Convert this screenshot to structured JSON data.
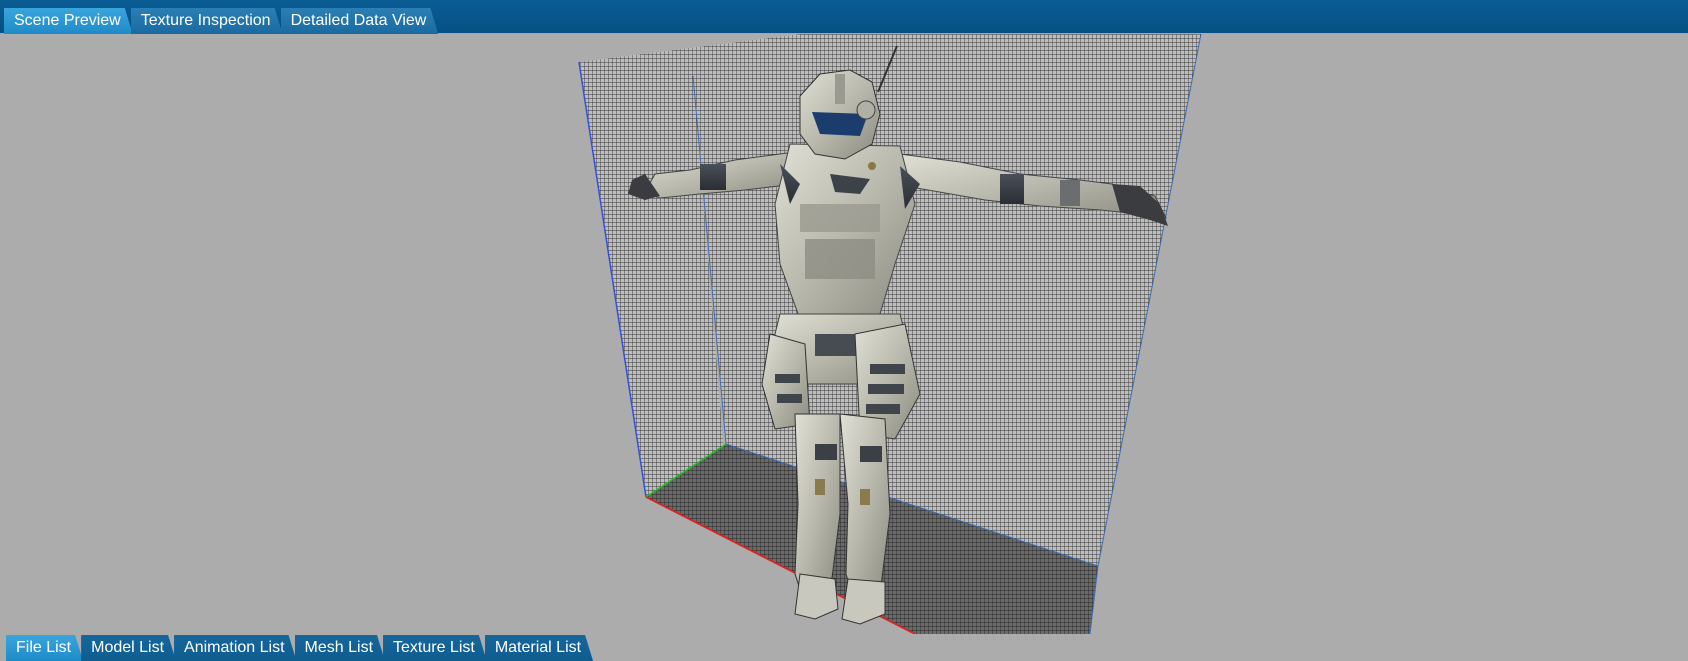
{
  "top_tabs": [
    {
      "label": "Scene Preview",
      "active": true
    },
    {
      "label": "Texture Inspection",
      "active": false
    },
    {
      "label": "Detailed Data View",
      "active": false
    }
  ],
  "bottom_tabs": [
    {
      "label": "File List",
      "active": true
    },
    {
      "label": "Model List",
      "active": false
    },
    {
      "label": "Animation List",
      "active": false
    },
    {
      "label": "Mesh List",
      "active": false
    },
    {
      "label": "Texture List",
      "active": false
    },
    {
      "label": "Material List",
      "active": false
    }
  ],
  "colors": {
    "top_bar": "#045083",
    "active_tab": "#1e8cc8",
    "viewport_bg": "#acacac",
    "axis_x": "#e02020",
    "axis_y": "#20c020",
    "axis_z": "#2040e0"
  },
  "viewport": {
    "model_icon": "armored-character-model"
  }
}
